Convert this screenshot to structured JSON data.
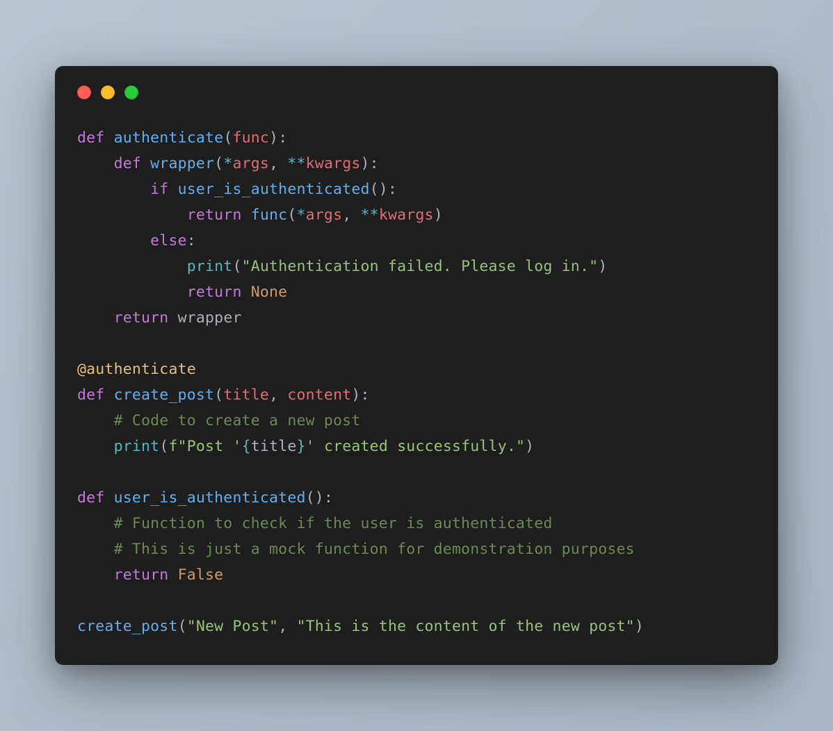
{
  "code": {
    "tokens": [
      [
        {
          "t": "def ",
          "c": "kw"
        },
        {
          "t": "authenticate",
          "c": "fn"
        },
        {
          "t": "(",
          "c": "pln"
        },
        {
          "t": "func",
          "c": "param"
        },
        {
          "t": "):",
          "c": "pln"
        }
      ],
      [
        {
          "t": "    ",
          "c": "pln"
        },
        {
          "t": "def ",
          "c": "kw"
        },
        {
          "t": "wrapper",
          "c": "fn"
        },
        {
          "t": "(",
          "c": "pln"
        },
        {
          "t": "*",
          "c": "op"
        },
        {
          "t": "args",
          "c": "param"
        },
        {
          "t": ", ",
          "c": "pln"
        },
        {
          "t": "**",
          "c": "op"
        },
        {
          "t": "kwargs",
          "c": "param"
        },
        {
          "t": "):",
          "c": "pln"
        }
      ],
      [
        {
          "t": "        ",
          "c": "pln"
        },
        {
          "t": "if ",
          "c": "kw"
        },
        {
          "t": "user_is_authenticated",
          "c": "fn"
        },
        {
          "t": "():",
          "c": "pln"
        }
      ],
      [
        {
          "t": "            ",
          "c": "pln"
        },
        {
          "t": "return ",
          "c": "kw"
        },
        {
          "t": "func",
          "c": "fn"
        },
        {
          "t": "(",
          "c": "pln"
        },
        {
          "t": "*",
          "c": "op"
        },
        {
          "t": "args",
          "c": "param"
        },
        {
          "t": ", ",
          "c": "pln"
        },
        {
          "t": "**",
          "c": "op"
        },
        {
          "t": "kwargs",
          "c": "param"
        },
        {
          "t": ")",
          "c": "pln"
        }
      ],
      [
        {
          "t": "        ",
          "c": "pln"
        },
        {
          "t": "else",
          "c": "kw"
        },
        {
          "t": ":",
          "c": "pln"
        }
      ],
      [
        {
          "t": "            ",
          "c": "pln"
        },
        {
          "t": "print",
          "c": "built"
        },
        {
          "t": "(",
          "c": "pln"
        },
        {
          "t": "\"Authentication failed. Please log in.\"",
          "c": "str"
        },
        {
          "t": ")",
          "c": "pln"
        }
      ],
      [
        {
          "t": "            ",
          "c": "pln"
        },
        {
          "t": "return ",
          "c": "kw"
        },
        {
          "t": "None",
          "c": "const"
        }
      ],
      [
        {
          "t": "    ",
          "c": "pln"
        },
        {
          "t": "return ",
          "c": "kw"
        },
        {
          "t": "wrapper",
          "c": "pln"
        }
      ],
      [],
      [
        {
          "t": "@authenticate",
          "c": "var"
        }
      ],
      [
        {
          "t": "def ",
          "c": "kw"
        },
        {
          "t": "create_post",
          "c": "fn"
        },
        {
          "t": "(",
          "c": "pln"
        },
        {
          "t": "title",
          "c": "param"
        },
        {
          "t": ", ",
          "c": "pln"
        },
        {
          "t": "content",
          "c": "param"
        },
        {
          "t": "):",
          "c": "pln"
        }
      ],
      [
        {
          "t": "    ",
          "c": "pln"
        },
        {
          "t": "# Code to create a new post",
          "c": "com"
        }
      ],
      [
        {
          "t": "    ",
          "c": "pln"
        },
        {
          "t": "print",
          "c": "built"
        },
        {
          "t": "(",
          "c": "pln"
        },
        {
          "t": "f\"Post '",
          "c": "str"
        },
        {
          "t": "{",
          "c": "op"
        },
        {
          "t": "title",
          "c": "pln"
        },
        {
          "t": "}",
          "c": "op"
        },
        {
          "t": "' created successfully.\"",
          "c": "str"
        },
        {
          "t": ")",
          "c": "pln"
        }
      ],
      [],
      [
        {
          "t": "def ",
          "c": "kw"
        },
        {
          "t": "user_is_authenticated",
          "c": "fn"
        },
        {
          "t": "():",
          "c": "pln"
        }
      ],
      [
        {
          "t": "    ",
          "c": "pln"
        },
        {
          "t": "# Function to check if the user is authenticated",
          "c": "com"
        }
      ],
      [
        {
          "t": "    ",
          "c": "pln"
        },
        {
          "t": "# This is just a mock function for demonstration purposes",
          "c": "com"
        }
      ],
      [
        {
          "t": "    ",
          "c": "pln"
        },
        {
          "t": "return ",
          "c": "kw"
        },
        {
          "t": "False",
          "c": "const"
        }
      ],
      [],
      [
        {
          "t": "create_post",
          "c": "fn"
        },
        {
          "t": "(",
          "c": "pln"
        },
        {
          "t": "\"New Post\"",
          "c": "str"
        },
        {
          "t": ", ",
          "c": "pln"
        },
        {
          "t": "\"This is the content of the new post\"",
          "c": "str"
        },
        {
          "t": ")",
          "c": "pln"
        }
      ]
    ]
  }
}
